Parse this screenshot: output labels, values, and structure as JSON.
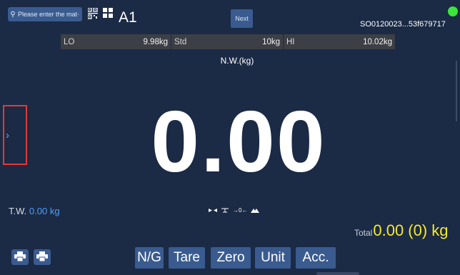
{
  "header": {
    "search_placeholder": "Please enter the mat·",
    "scale_id": "A1",
    "next_label": "Next",
    "serial": "SO0120023...53f679717",
    "status_color": "#3ce53c"
  },
  "limits": {
    "lo_label": "LO",
    "lo_value": "9.98kg",
    "std_label": "Std",
    "std_value": "10kg",
    "hi_label": "HI",
    "hi_value": "10.02kg"
  },
  "reading": {
    "mode_label": "N.W.(kg)",
    "value": "0.00"
  },
  "tare": {
    "label": "T.W.",
    "value": "0.00 kg"
  },
  "status_icons": [
    "stable-icon",
    "tare-icon",
    "zero-icon",
    "net-icon"
  ],
  "total": {
    "label": "Total",
    "value": "0.00 (0) kg"
  },
  "actions": {
    "ng": "N/G",
    "tare": "Tare",
    "zero": "Zero",
    "unit": "Unit",
    "acc": "Acc."
  },
  "colors": {
    "background": "#1b2a45",
    "button": "#3a5b8f",
    "accent_blue": "#4aa0ff",
    "total_yellow": "#f5ea2a"
  }
}
